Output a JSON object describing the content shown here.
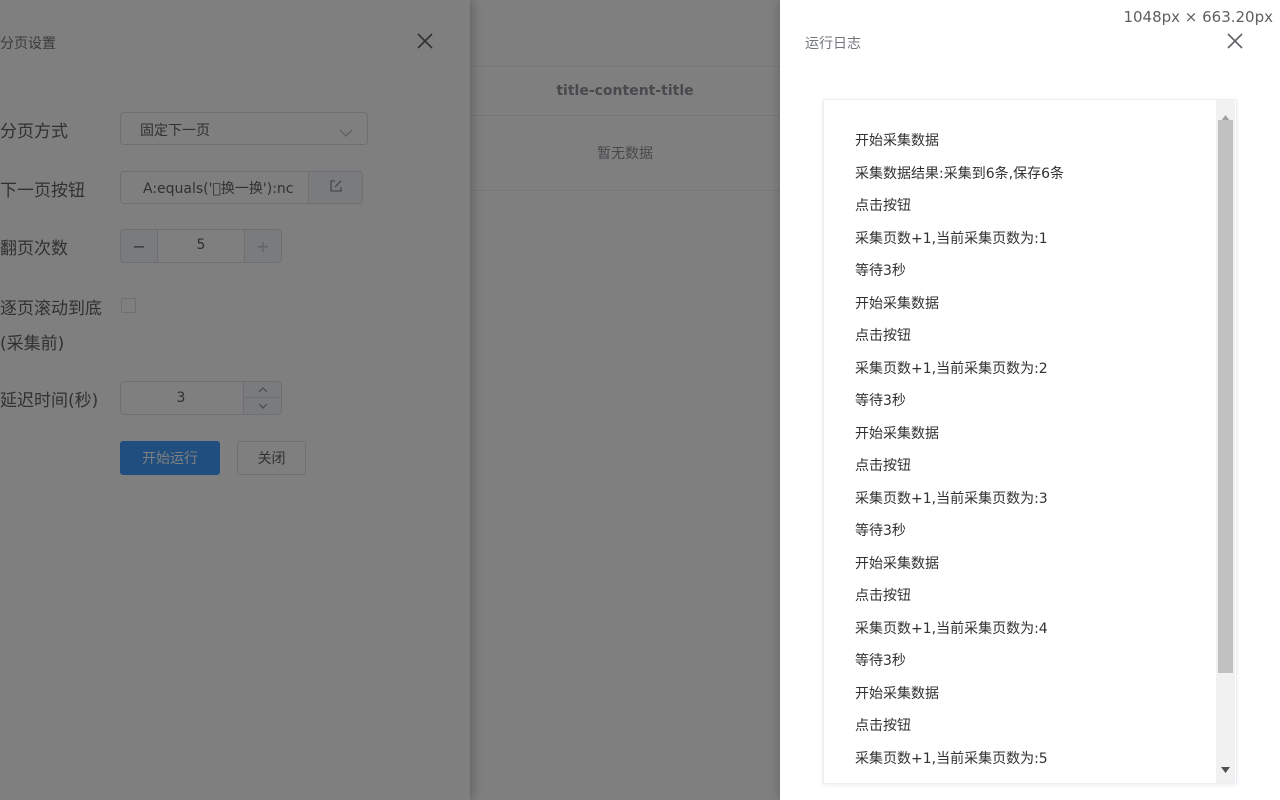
{
  "background_table": {
    "header": "title-content-title",
    "empty_text": "暂无数据"
  },
  "settings_panel": {
    "title": "分页设置",
    "close_icon": "close-icon",
    "fields": {
      "paging_method_label": "分页方式",
      "paging_method_value": "固定下一页",
      "next_button_label": "下一页按钮",
      "next_button_value": "A:equals('\u0000换一换'):nc",
      "page_count_label": "翻页次数",
      "page_count_value": "5",
      "scroll_label_line1": "逐页滚动到底",
      "scroll_label_line2": "(采集前)",
      "delay_label": "延迟时间(秒)",
      "delay_value": "3"
    },
    "buttons": {
      "start": "开始运行",
      "close": "关闭"
    }
  },
  "log_panel": {
    "title": "运行日志",
    "dimension_readout": "1048px × 663.20px",
    "entries": [
      "开始采集数据",
      "采集数据结果:采集到6条,保存6条",
      "点击按钮",
      "采集页数+1,当前采集页数为:1",
      "等待3秒",
      "开始采集数据",
      "点击按钮",
      "采集页数+1,当前采集页数为:2",
      "等待3秒",
      "开始采集数据",
      "点击按钮",
      "采集页数+1,当前采集页数为:3",
      "等待3秒",
      "开始采集数据",
      "点击按钮",
      "采集页数+1,当前采集页数为:4",
      "等待3秒",
      "开始采集数据",
      "点击按钮",
      "采集页数+1,当前采集页数为:5"
    ]
  },
  "colors": {
    "primary": "#409eff",
    "mask": "rgba(0,0,0,0.5)"
  }
}
